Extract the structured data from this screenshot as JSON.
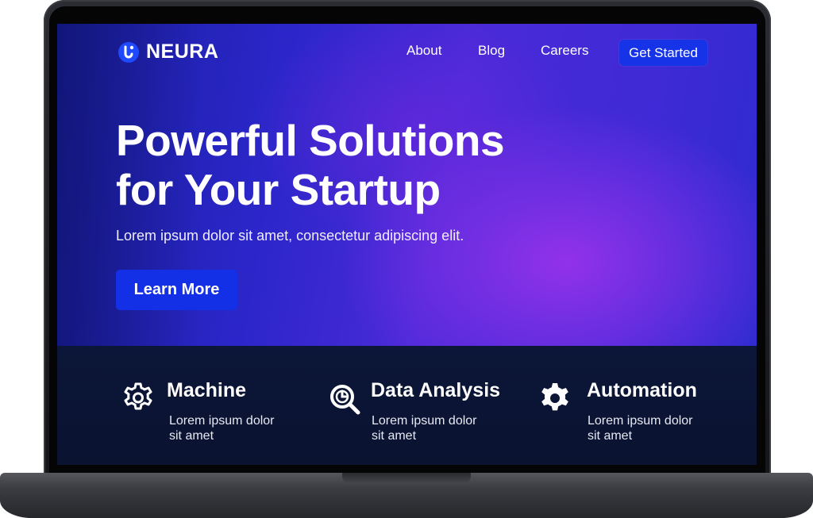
{
  "brand": {
    "name": "NEURA",
    "icon": "neura-logo-icon"
  },
  "nav": {
    "links": [
      "About",
      "Blog",
      "Careers"
    ],
    "cta_label": "Get Started"
  },
  "hero": {
    "headline_line1": "Powerful Solutions",
    "headline_line2": "for Your Startup",
    "subtitle": "Lorem ipsum dolor sit amet, consectetur adipiscing elit.",
    "cta_label": "Learn More"
  },
  "features": [
    {
      "title": "Machine",
      "desc_line1": "Lorem ipsum dolor",
      "desc_line2": "sit amet",
      "icon": "gear-outline-icon"
    },
    {
      "title": "Data Analysis",
      "desc_line1": "Lorem ipsum dolor",
      "desc_line2": "sit amet",
      "icon": "magnifier-chart-icon"
    },
    {
      "title": "Automation",
      "desc_line1": "Lorem ipsum dolor",
      "desc_line2": "sit amet",
      "icon": "gear-filled-icon"
    }
  ],
  "colors": {
    "accent": "#1733e8",
    "hero_start": "#1a1fa0",
    "hero_glow": "#9632eb",
    "features_bg": "#0a1330"
  }
}
